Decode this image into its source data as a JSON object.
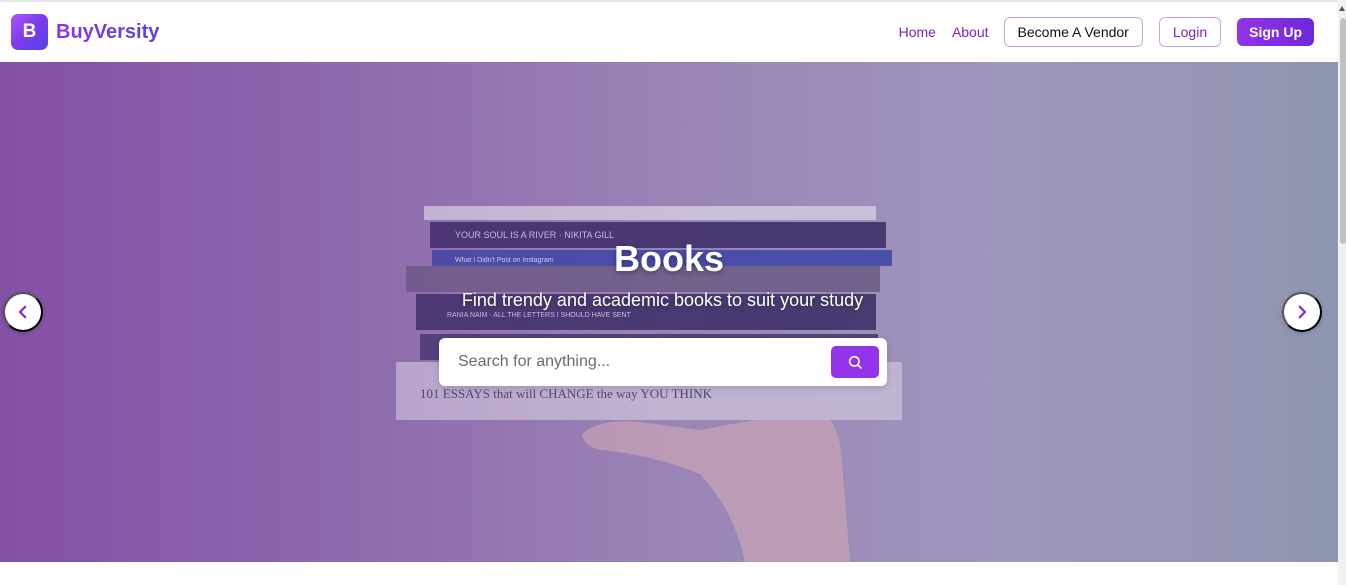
{
  "brand": {
    "logo_letter": "B",
    "name": "BuyVersity"
  },
  "nav": {
    "home": "Home",
    "about": "About",
    "become_vendor": "Become A Vendor",
    "login": "Login",
    "signup": "Sign Up"
  },
  "hero": {
    "title": "Books",
    "subtitle": "Find trendy and academic books to suit your study",
    "search_placeholder": "Search for anything..."
  },
  "icons": {
    "search": "search-icon",
    "prev": "chevron-left-icon",
    "next": "chevron-right-icon"
  },
  "colors": {
    "accent": "#9333ea",
    "nav_link": "#7e22ce",
    "brand_gradient_start": "#9333ea",
    "brand_gradient_end": "#4f46e5"
  }
}
